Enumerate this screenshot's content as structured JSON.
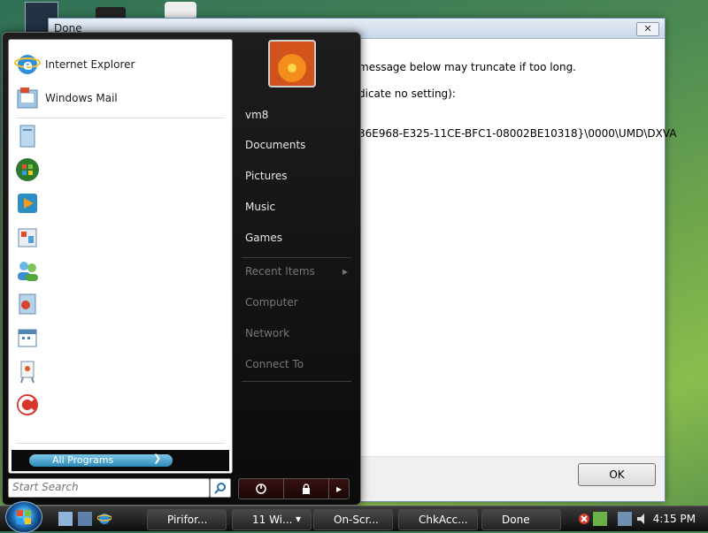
{
  "dialog": {
    "title": "Done",
    "close_glyph": "✕",
    "lines": [
      "message below may truncate if too long.",
      "dicate no setting):",
      "36E968-E325-11CE-BFC1-08002BE10318}\\0000\\UMD\\DXVA"
    ],
    "ok_label": "OK"
  },
  "start_menu": {
    "pinned": [
      {
        "label": "Internet Explorer",
        "icon": "internet-explorer-icon"
      },
      {
        "label": "Windows Mail",
        "icon": "windows-mail-icon"
      }
    ],
    "recent_icons": [
      "document-icon",
      "windows-logo-icon",
      "media-player-icon",
      "photo-gallery-icon",
      "contacts-icon",
      "media-center-icon",
      "calendar-icon",
      "paint-icon",
      "ccleaner-icon"
    ],
    "all_programs": "All Programs",
    "search_placeholder": "Start Search",
    "right_items": [
      {
        "label": "vm8",
        "dim": false
      },
      {
        "label": "Documents",
        "dim": false
      },
      {
        "label": "Pictures",
        "dim": false
      },
      {
        "label": "Music",
        "dim": false
      },
      {
        "label": "Games",
        "dim": false
      },
      {
        "label": "Recent Items",
        "dim": true
      },
      {
        "label": "Computer",
        "dim": true
      },
      {
        "label": "Network",
        "dim": true
      },
      {
        "label": "Connect To",
        "dim": true
      }
    ]
  },
  "taskbar": {
    "buttons": [
      {
        "label": "Pirifor..."
      },
      {
        "label": "11 Wi..."
      },
      {
        "label": "On-Scr..."
      },
      {
        "label": "ChkAcc..."
      },
      {
        "label": "Done"
      }
    ],
    "clock": "4:15 PM"
  },
  "colors": {
    "accent": "#2b8ab8",
    "taskbar": "#1a1a1a"
  }
}
